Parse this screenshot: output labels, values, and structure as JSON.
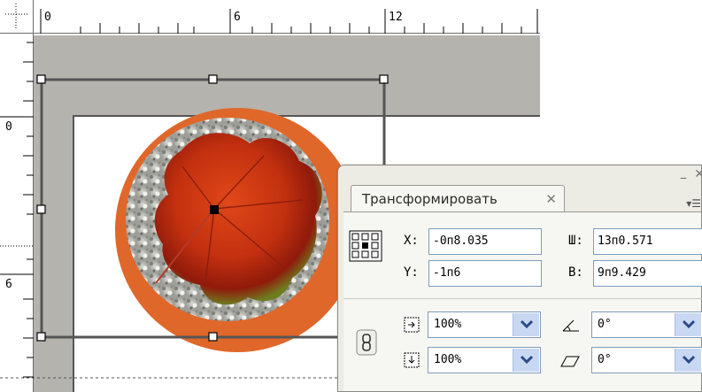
{
  "rulers": {
    "horizontal_labels": [
      "0",
      "6",
      "12"
    ],
    "vertical_labels": [
      "0",
      "6"
    ]
  },
  "panel": {
    "tab_title": "Трансформировать",
    "close_glyph": "✕",
    "menu_glyph": "▾☰",
    "minimize_glyph": "–"
  },
  "fields": {
    "x_label": "X:",
    "x_value": "-0п8.035",
    "w_label": "Ш:",
    "w_value": "13п0.571",
    "y_label": "Y:",
    "y_value": "-1п6",
    "h_label": "В:",
    "h_value": "9п9.429",
    "scale_x_value": "100%",
    "scale_y_value": "100%",
    "rotate_value": "0°",
    "shear_value": "0°"
  },
  "colors": {
    "pasteboard": "#b4b3ad",
    "ring": "#e0672a",
    "selection": "#555555",
    "dropdown": "#c9d8f2"
  }
}
